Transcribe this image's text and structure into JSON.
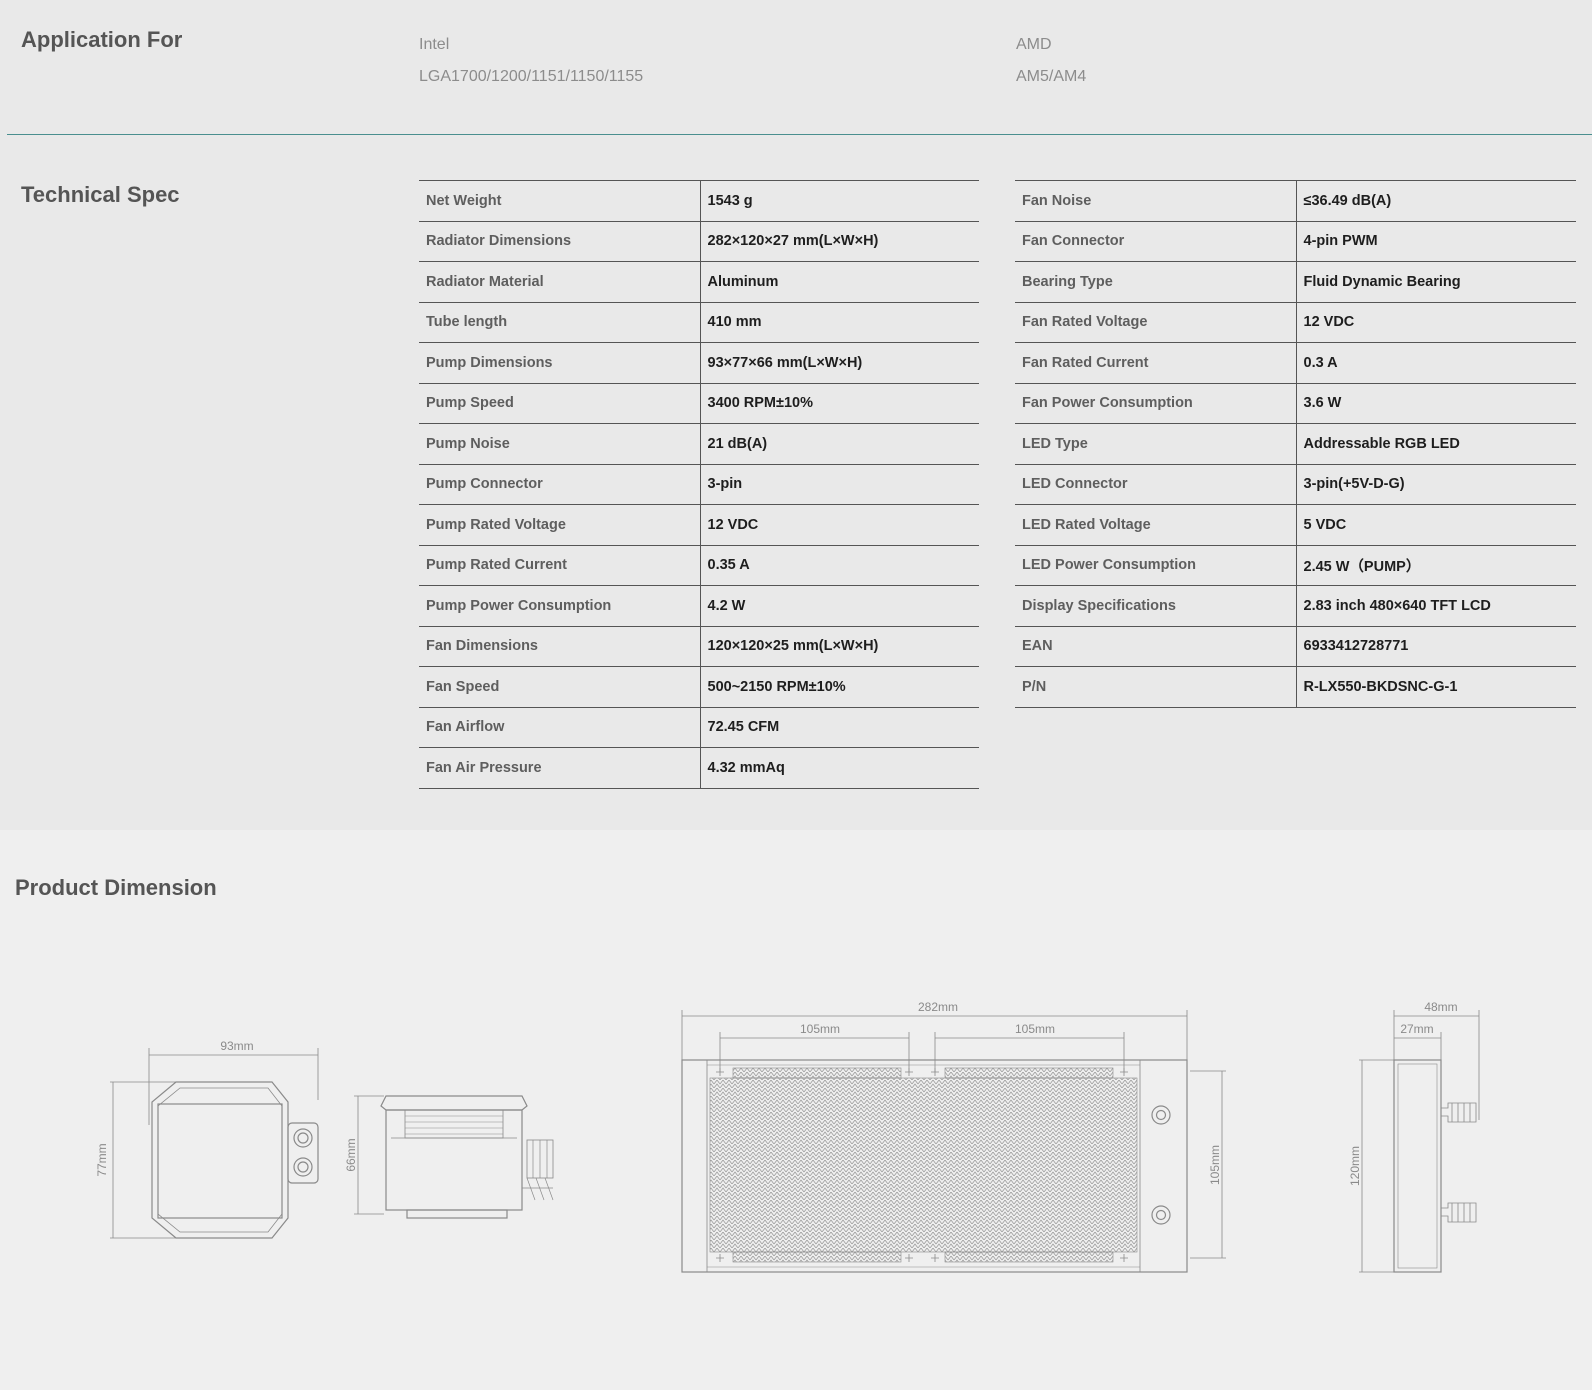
{
  "application": {
    "title": "Application For",
    "intel": {
      "label": "Intel",
      "sockets": "LGA1700/1200/1151/1150/1155"
    },
    "amd": {
      "label": "AMD",
      "sockets": "AM5/AM4"
    }
  },
  "technical": {
    "title": "Technical Spec",
    "left": [
      {
        "key": "Net Weight",
        "value": "1543 g"
      },
      {
        "key": "Radiator Dimensions",
        "value": "282×120×27 mm(L×W×H)"
      },
      {
        "key": "Radiator Material",
        "value": "Aluminum"
      },
      {
        "key": "Tube length",
        "value": "410 mm"
      },
      {
        "key": "Pump Dimensions",
        "value": "93×77×66 mm(L×W×H)"
      },
      {
        "key": "Pump Speed",
        "value": "3400 RPM±10%"
      },
      {
        "key": "Pump Noise",
        "value": "21 dB(A)"
      },
      {
        "key": "Pump Connector",
        "value": "3-pin"
      },
      {
        "key": "Pump Rated Voltage",
        "value": "12 VDC"
      },
      {
        "key": "Pump Rated Current",
        "value": "0.35 A"
      },
      {
        "key": "Pump Power Consumption",
        "value": "4.2 W"
      },
      {
        "key": "Fan Dimensions",
        "value": "120×120×25 mm(L×W×H)"
      },
      {
        "key": "Fan Speed",
        "value": "500~2150 RPM±10%"
      },
      {
        "key": "Fan Airflow",
        "value": "72.45 CFM"
      },
      {
        "key": "Fan Air Pressure",
        "value": "4.32 mmAq"
      }
    ],
    "right": [
      {
        "key": "Fan Noise",
        "value": "≤36.49 dB(A)"
      },
      {
        "key": "Fan Connector",
        "value": "4-pin PWM"
      },
      {
        "key": "Bearing Type",
        "value": "Fluid Dynamic Bearing"
      },
      {
        "key": "Fan Rated Voltage",
        "value": "12 VDC"
      },
      {
        "key": "Fan Rated Current",
        "value": "0.3 A"
      },
      {
        "key": "Fan Power Consumption",
        "value": "3.6 W"
      },
      {
        "key": "LED Type",
        "value": "Addressable RGB LED"
      },
      {
        "key": "LED Connector",
        "value": "3-pin(+5V-D-G)"
      },
      {
        "key": "LED Rated Voltage",
        "value": "5 VDC"
      },
      {
        "key": "LED Power Consumption",
        "value": "2.45 W（PUMP）"
      },
      {
        "key": "Display Specifications",
        "value": "2.83 inch 480×640 TFT LCD"
      },
      {
        "key": "EAN",
        "value": "6933412728771"
      },
      {
        "key": "P/N",
        "value": "R-LX550-BKDSNC-G-1"
      }
    ]
  },
  "dimension": {
    "title": "Product Dimension",
    "pump_front": {
      "width": "93mm",
      "height": "77mm"
    },
    "pump_side": {
      "height": "66mm"
    },
    "radiator_front": {
      "length": "282mm",
      "hole_spacing_1": "105mm",
      "hole_spacing_2": "105mm",
      "height": "105mm"
    },
    "radiator_side": {
      "total_depth": "48mm",
      "depth": "27mm",
      "height": "120mm"
    }
  }
}
